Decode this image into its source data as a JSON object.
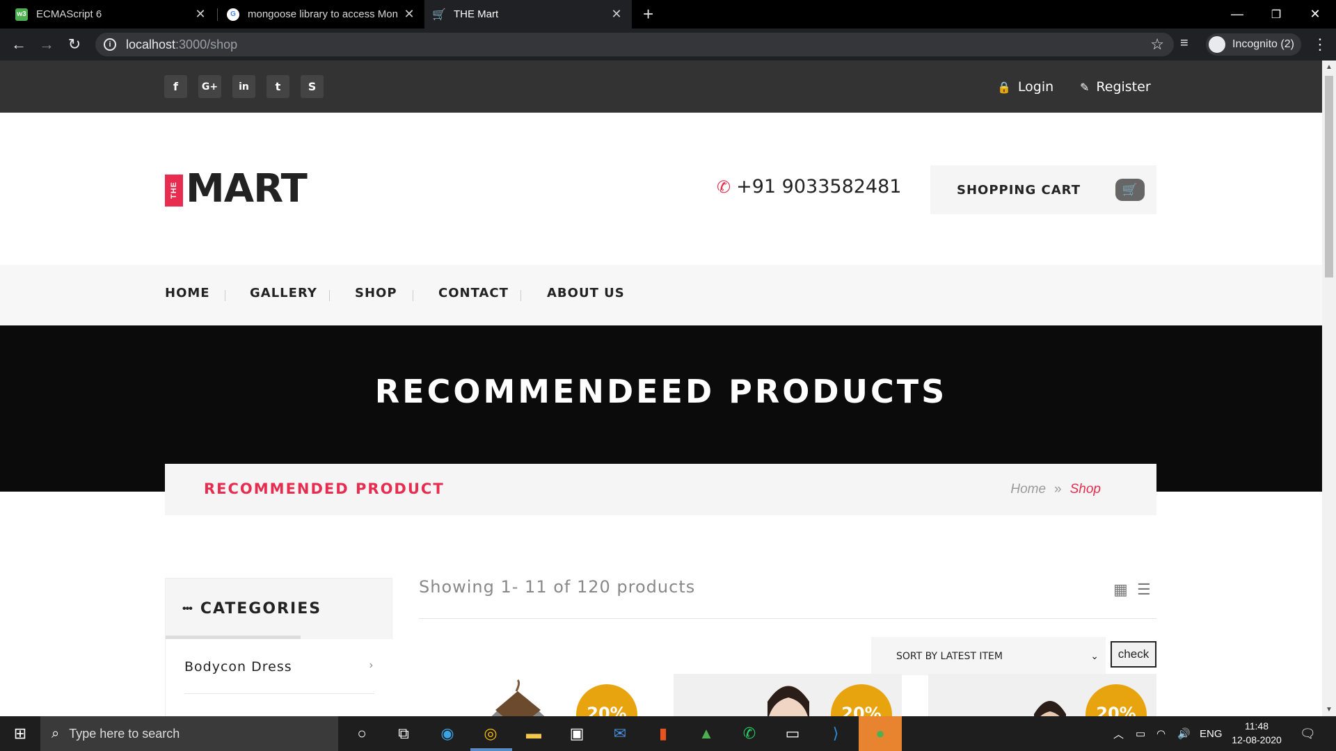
{
  "browser": {
    "tabs": [
      {
        "title": "ECMAScript 6",
        "favicon": "w3-icon",
        "active": false
      },
      {
        "title": "mongoose library to access Mon",
        "favicon": "google-icon",
        "active": false
      },
      {
        "title": "THE Mart",
        "favicon": "cart-icon",
        "active": true
      }
    ],
    "url_host": "localhost",
    "url_path": ":3000/shop",
    "profile": "Incognito (2)"
  },
  "site": {
    "social_icons": [
      {
        "name": "facebook-icon",
        "glyph": "f"
      },
      {
        "name": "google-plus-icon",
        "glyph": "G+"
      },
      {
        "name": "linkedin-icon",
        "glyph": "in"
      },
      {
        "name": "twitter-icon",
        "glyph": "t"
      },
      {
        "name": "skype-icon",
        "glyph": "S"
      }
    ],
    "login_label": "Login",
    "register_label": "Register",
    "logo_the": "THE",
    "logo_mart": "MART",
    "phone": "+91 9033582481",
    "cart_label": "SHOPPING CART",
    "nav": [
      "HOME",
      "GALLERY",
      "SHOP",
      "CONTACT",
      "ABOUT US"
    ],
    "hero_title": "RECOMMENDEED PRODUCTS",
    "breadcrumb_title": "RECOMMENDED PRODUCT",
    "breadcrumb_home": "Home",
    "breadcrumb_sep": "»",
    "breadcrumb_current": "Shop",
    "categories_title": "CATEGORIES",
    "categories": [
      "Bodycon Dress"
    ],
    "showing_text": "Showing 1- 11 of 120 products",
    "sort_label": "SORT BY LATEST ITEM",
    "check_label": "check",
    "products": [
      {
        "badge": "20%"
      },
      {
        "badge": "20%"
      },
      {
        "badge": "20%"
      }
    ],
    "accent_color": "#e82c4f",
    "badge_color": "#e8a40f"
  },
  "taskbar": {
    "search_placeholder": "Type here to search",
    "language": "ENG",
    "time": "11:48",
    "date": "12-08-2020"
  }
}
